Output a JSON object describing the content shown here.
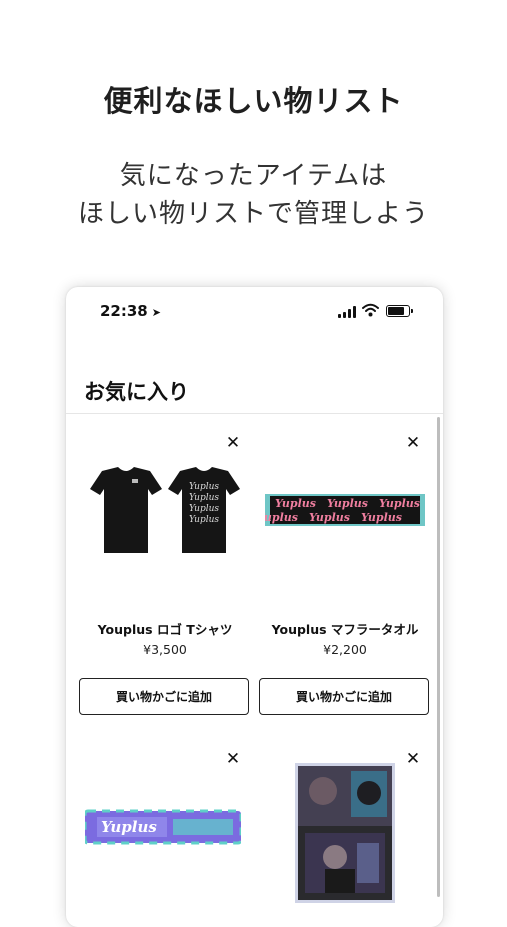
{
  "promo": {
    "headline": "便利なほしい物リスト",
    "subline1": "気になったアイテムは",
    "subline2": "ほしい物リストで管理しよう"
  },
  "status_bar": {
    "time": "22:38",
    "location_glyph": "➤"
  },
  "screen": {
    "title": "お気に入り",
    "close_glyph": "✕",
    "items": [
      {
        "name": "Youplus ロゴ Tシャツ",
        "price": "¥3,500",
        "button": "買い物かごに追加",
        "image": "black-tshirt-front-back"
      },
      {
        "name": "Youplus マフラータオル",
        "price": "¥2,200",
        "button": "買い物かごに追加",
        "image": "muffler-towel"
      },
      {
        "name": "",
        "price": "",
        "button": "",
        "image": "penlight-stick"
      },
      {
        "name": "",
        "price": "",
        "button": "",
        "image": "photo-card"
      }
    ]
  },
  "image_text": {
    "tshirt_print": "Yuplus",
    "towel_print": "Yuplus",
    "stick_print": "Yuplus"
  },
  "colors": {
    "tshirt": "#151515",
    "towel_bg": "#141414",
    "towel_text": "#f07fa0",
    "towel_border": "#6fc6c6",
    "stick_bg": "#7b6be0",
    "stick_accent": "#5fd0c8"
  }
}
